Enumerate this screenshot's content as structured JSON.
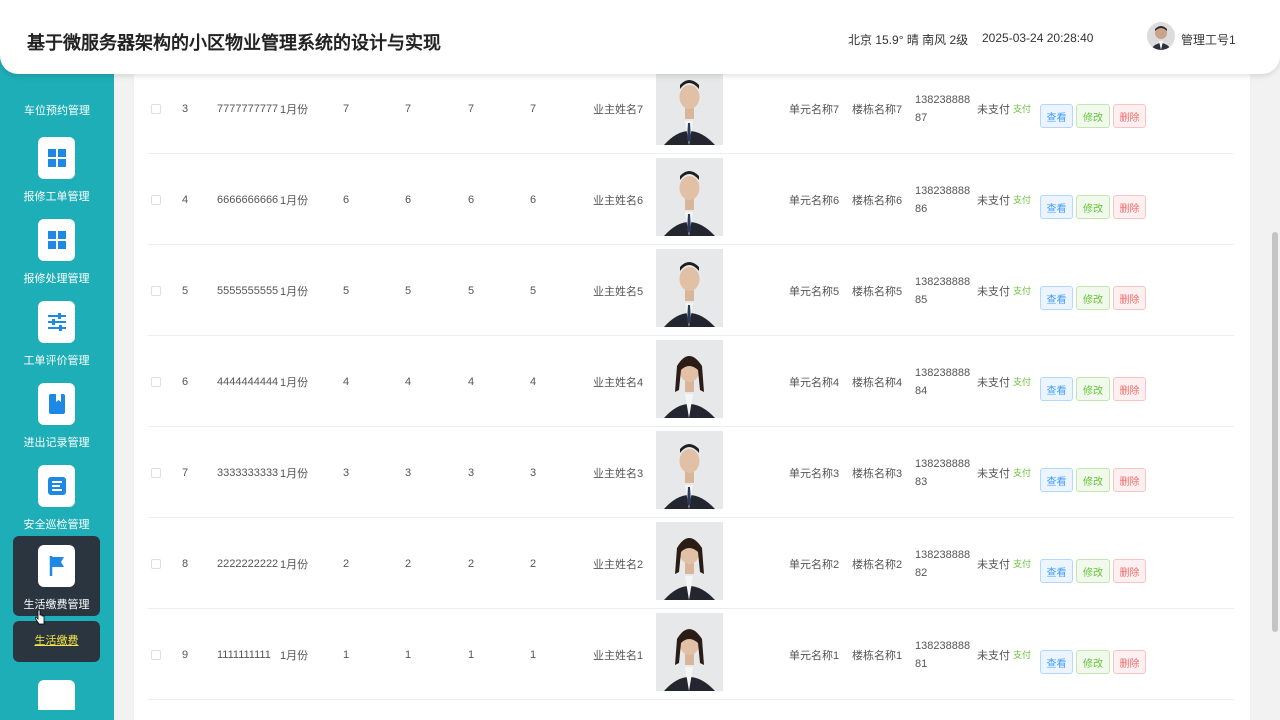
{
  "header": {
    "title": "基于微服务器架构的小区物业管理系统的设计与实现",
    "weather": "北京  15.9°  晴  南风  2级",
    "datetime": "2025-03-24 20:28:40",
    "user": "管理工号1"
  },
  "sidebar": {
    "top_label": "车位预约管理",
    "items": [
      {
        "label": "报修工单管理",
        "icon": "grid-icon"
      },
      {
        "label": "报修处理管理",
        "icon": "grid-icon"
      },
      {
        "label": "工单评价管理",
        "icon": "sliders-icon"
      },
      {
        "label": "进出记录管理",
        "icon": "book-icon"
      },
      {
        "label": "安全巡检管理",
        "icon": "list-icon"
      },
      {
        "label": "生活缴费管理",
        "icon": "flag-icon"
      }
    ],
    "sub_item": "生活缴费"
  },
  "table": {
    "rows": [
      {
        "index": "3",
        "code": "7777777777",
        "month": "1月份",
        "v1": "7",
        "v2": "7",
        "v3": "7",
        "v4": "7",
        "owner": "业主姓名7",
        "unit": "单元名称7",
        "building": "楼栋名称7",
        "phone": "13823888887",
        "status": "未支付",
        "pay": "支付",
        "photo_gender": "male"
      },
      {
        "index": "4",
        "code": "6666666666",
        "month": "1月份",
        "v1": "6",
        "v2": "6",
        "v3": "6",
        "v4": "6",
        "owner": "业主姓名6",
        "unit": "单元名称6",
        "building": "楼栋名称6",
        "phone": "13823888886",
        "status": "未支付",
        "pay": "支付",
        "photo_gender": "male"
      },
      {
        "index": "5",
        "code": "5555555555",
        "month": "1月份",
        "v1": "5",
        "v2": "5",
        "v3": "5",
        "v4": "5",
        "owner": "业主姓名5",
        "unit": "单元名称5",
        "building": "楼栋名称5",
        "phone": "13823888885",
        "status": "未支付",
        "pay": "支付",
        "photo_gender": "male"
      },
      {
        "index": "6",
        "code": "4444444444",
        "month": "1月份",
        "v1": "4",
        "v2": "4",
        "v3": "4",
        "v4": "4",
        "owner": "业主姓名4",
        "unit": "单元名称4",
        "building": "楼栋名称4",
        "phone": "13823888884",
        "status": "未支付",
        "pay": "支付",
        "photo_gender": "female"
      },
      {
        "index": "7",
        "code": "3333333333",
        "month": "1月份",
        "v1": "3",
        "v2": "3",
        "v3": "3",
        "v4": "3",
        "owner": "业主姓名3",
        "unit": "单元名称3",
        "building": "楼栋名称3",
        "phone": "13823888883",
        "status": "未支付",
        "pay": "支付",
        "photo_gender": "male"
      },
      {
        "index": "8",
        "code": "2222222222",
        "month": "1月份",
        "v1": "2",
        "v2": "2",
        "v3": "2",
        "v4": "2",
        "owner": "业主姓名2",
        "unit": "单元名称2",
        "building": "楼栋名称2",
        "phone": "13823888882",
        "status": "未支付",
        "pay": "支付",
        "photo_gender": "female"
      },
      {
        "index": "9",
        "code": "1111111111",
        "month": "1月份",
        "v1": "1",
        "v2": "1",
        "v3": "1",
        "v4": "1",
        "owner": "业主姓名1",
        "unit": "单元名称1",
        "building": "楼栋名称1",
        "phone": "13823888881",
        "status": "未支付",
        "pay": "支付",
        "photo_gender": "female"
      }
    ],
    "actions": {
      "view": "查看",
      "edit": "修改",
      "delete": "删除"
    }
  },
  "colors": {
    "sidebar": "#1eaeb7",
    "active": "#2a3540",
    "highlight": "#f5e642"
  }
}
